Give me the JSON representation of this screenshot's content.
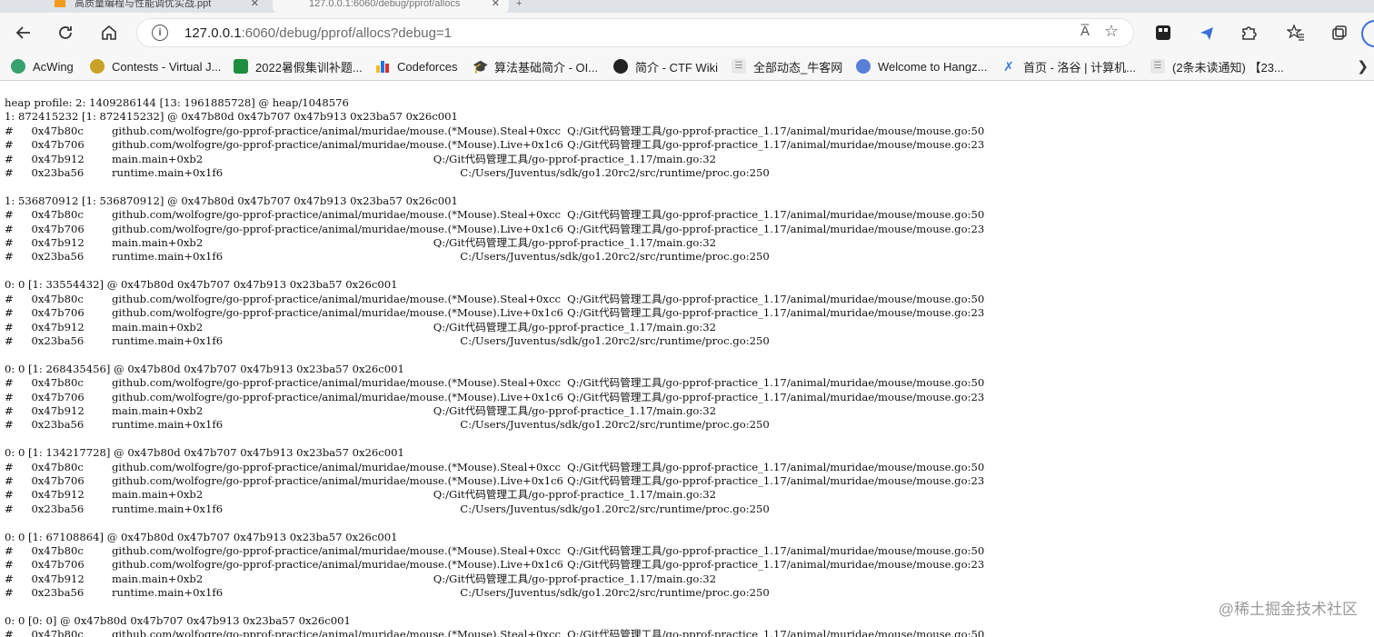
{
  "browser": {
    "tabs": [
      {
        "label": "高质量编程与性能调优实战.ppt"
      },
      {
        "label": "127.0.0.1:6060/debug/pprof/allocs"
      }
    ],
    "new_tab_label": "+",
    "url_host": "127.0.0.1",
    "url_rest": ":6060/debug/pprof/allocs?debug=1",
    "read_aloud_label": "A̅",
    "icons": {
      "back": "back-arrow-icon",
      "refresh": "refresh-icon",
      "home": "home-icon",
      "info": "info-icon",
      "favorite": "star-plus-icon",
      "extensions": "puzzle-icon",
      "favorites": "favorites-list-icon",
      "collections": "collections-icon"
    }
  },
  "bookmarks": [
    {
      "label": "AcWing",
      "icon": "acwing-icon",
      "color": "#39a16b"
    },
    {
      "label": "Contests - Virtual J...",
      "icon": "vjudge-icon",
      "color": "#c9a227"
    },
    {
      "label": "2022暑假集训补题...",
      "icon": "sheet-icon",
      "color": "#1e8e3e"
    },
    {
      "label": "Codeforces",
      "icon": "codeforces-icon",
      "color": "#1a73e8"
    },
    {
      "label": "算法基础简介 - OI...",
      "icon": "graduation-cap-icon",
      "color": "#222222"
    },
    {
      "label": "简介 - CTF Wiki",
      "icon": "github-icon",
      "color": "#222222"
    },
    {
      "label": "全部动态_牛客网",
      "icon": "nowcoder-icon",
      "color": "#c8c8c8"
    },
    {
      "label": "Welcome to Hangz...",
      "icon": "hdu-icon",
      "color": "#5a7fd6"
    },
    {
      "label": "首页 - 洛谷 | 计算机...",
      "icon": "luogu-icon",
      "color": "#3b7ddd"
    },
    {
      "label": "(2条未读通知) 【23...",
      "icon": "csdn-icon",
      "color": "#c8c8c8"
    }
  ],
  "body_text": "heap profile: 2: 1409286144 [13: 1961885728] @ heap/1048576\n1: 872415232 [1: 872415232] @ 0x47b80d 0x47b707 0x47b913 0x23ba57 0x26c001\n#\t0x47b80c\tgithub.com/wolfogre/go-pprof-practice/animal/muridae/mouse.(*Mouse).Steal+0xcc\tQ:/Git代码管理工具/go-pprof-practice_1.17/animal/muridae/mouse/mouse.go:50\n#\t0x47b706\tgithub.com/wolfogre/go-pprof-practice/animal/muridae/mouse.(*Mouse).Live+0x1c6\tQ:/Git代码管理工具/go-pprof-practice_1.17/animal/muridae/mouse/mouse.go:23\n#\t0x47b912\tmain.main+0xb2\t\t\t\t\t\t\t\t\tQ:/Git代码管理工具/go-pprof-practice_1.17/main.go:32\n#\t0x23ba56\truntime.main+0x1f6\t\t\t\t\t\t\t\t\tC:/Users/Juventus/sdk/go1.20rc2/src/runtime/proc.go:250\n\n1: 536870912 [1: 536870912] @ 0x47b80d 0x47b707 0x47b913 0x23ba57 0x26c001\n#\t0x47b80c\tgithub.com/wolfogre/go-pprof-practice/animal/muridae/mouse.(*Mouse).Steal+0xcc\tQ:/Git代码管理工具/go-pprof-practice_1.17/animal/muridae/mouse/mouse.go:50\n#\t0x47b706\tgithub.com/wolfogre/go-pprof-practice/animal/muridae/mouse.(*Mouse).Live+0x1c6\tQ:/Git代码管理工具/go-pprof-practice_1.17/animal/muridae/mouse/mouse.go:23\n#\t0x47b912\tmain.main+0xb2\t\t\t\t\t\t\t\t\tQ:/Git代码管理工具/go-pprof-practice_1.17/main.go:32\n#\t0x23ba56\truntime.main+0x1f6\t\t\t\t\t\t\t\t\tC:/Users/Juventus/sdk/go1.20rc2/src/runtime/proc.go:250\n\n0: 0 [1: 33554432] @ 0x47b80d 0x47b707 0x47b913 0x23ba57 0x26c001\n#\t0x47b80c\tgithub.com/wolfogre/go-pprof-practice/animal/muridae/mouse.(*Mouse).Steal+0xcc\tQ:/Git代码管理工具/go-pprof-practice_1.17/animal/muridae/mouse/mouse.go:50\n#\t0x47b706\tgithub.com/wolfogre/go-pprof-practice/animal/muridae/mouse.(*Mouse).Live+0x1c6\tQ:/Git代码管理工具/go-pprof-practice_1.17/animal/muridae/mouse/mouse.go:23\n#\t0x47b912\tmain.main+0xb2\t\t\t\t\t\t\t\t\tQ:/Git代码管理工具/go-pprof-practice_1.17/main.go:32\n#\t0x23ba56\truntime.main+0x1f6\t\t\t\t\t\t\t\t\tC:/Users/Juventus/sdk/go1.20rc2/src/runtime/proc.go:250\n\n0: 0 [1: 268435456] @ 0x47b80d 0x47b707 0x47b913 0x23ba57 0x26c001\n#\t0x47b80c\tgithub.com/wolfogre/go-pprof-practice/animal/muridae/mouse.(*Mouse).Steal+0xcc\tQ:/Git代码管理工具/go-pprof-practice_1.17/animal/muridae/mouse/mouse.go:50\n#\t0x47b706\tgithub.com/wolfogre/go-pprof-practice/animal/muridae/mouse.(*Mouse).Live+0x1c6\tQ:/Git代码管理工具/go-pprof-practice_1.17/animal/muridae/mouse/mouse.go:23\n#\t0x47b912\tmain.main+0xb2\t\t\t\t\t\t\t\t\tQ:/Git代码管理工具/go-pprof-practice_1.17/main.go:32\n#\t0x23ba56\truntime.main+0x1f6\t\t\t\t\t\t\t\t\tC:/Users/Juventus/sdk/go1.20rc2/src/runtime/proc.go:250\n\n0: 0 [1: 134217728] @ 0x47b80d 0x47b707 0x47b913 0x23ba57 0x26c001\n#\t0x47b80c\tgithub.com/wolfogre/go-pprof-practice/animal/muridae/mouse.(*Mouse).Steal+0xcc\tQ:/Git代码管理工具/go-pprof-practice_1.17/animal/muridae/mouse/mouse.go:50\n#\t0x47b706\tgithub.com/wolfogre/go-pprof-practice/animal/muridae/mouse.(*Mouse).Live+0x1c6\tQ:/Git代码管理工具/go-pprof-practice_1.17/animal/muridae/mouse/mouse.go:23\n#\t0x47b912\tmain.main+0xb2\t\t\t\t\t\t\t\t\tQ:/Git代码管理工具/go-pprof-practice_1.17/main.go:32\n#\t0x23ba56\truntime.main+0x1f6\t\t\t\t\t\t\t\t\tC:/Users/Juventus/sdk/go1.20rc2/src/runtime/proc.go:250\n\n0: 0 [1: 67108864] @ 0x47b80d 0x47b707 0x47b913 0x23ba57 0x26c001\n#\t0x47b80c\tgithub.com/wolfogre/go-pprof-practice/animal/muridae/mouse.(*Mouse).Steal+0xcc\tQ:/Git代码管理工具/go-pprof-practice_1.17/animal/muridae/mouse/mouse.go:50\n#\t0x47b706\tgithub.com/wolfogre/go-pprof-practice/animal/muridae/mouse.(*Mouse).Live+0x1c6\tQ:/Git代码管理工具/go-pprof-practice_1.17/animal/muridae/mouse/mouse.go:23\n#\t0x47b912\tmain.main+0xb2\t\t\t\t\t\t\t\t\tQ:/Git代码管理工具/go-pprof-practice_1.17/main.go:32\n#\t0x23ba56\truntime.main+0x1f6\t\t\t\t\t\t\t\t\tC:/Users/Juventus/sdk/go1.20rc2/src/runtime/proc.go:250\n\n0: 0 [0: 0] @ 0x47b80d 0x47b707 0x47b913 0x23ba57 0x26c001\n#\t0x47b80c\tgithub.com/wolfogre/go-pprof-practice/animal/muridae/mouse.(*Mouse).Steal+0xcc\tQ:/Git代码管理工具/go-pprof-practice_1.17/animal/muridae/mouse/mouse.go:50",
  "watermark": "@稀土掘金技术社区"
}
